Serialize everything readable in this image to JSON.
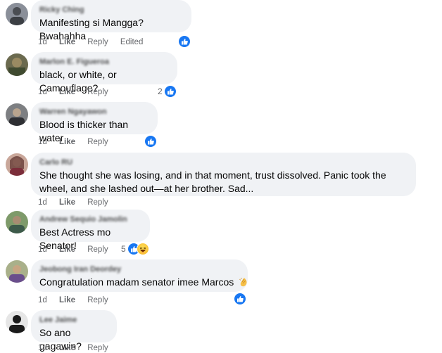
{
  "comments": [
    {
      "author": "Ricky Ching",
      "text": "Manifesting si Mangga? Bwahahha",
      "time": "1d",
      "like": "Like",
      "reply": "Reply",
      "edited": "Edited",
      "reaction_count": "",
      "reactions": [
        "like"
      ]
    },
    {
      "author": "Marlon E. Figueroa",
      "text": "black, or white, or Camouflage?",
      "time": "1d",
      "like": "Like",
      "reply": "Reply",
      "reaction_count": "2",
      "reactions": [
        "like"
      ]
    },
    {
      "author": "Warren Ngayawon",
      "text": "Blood is thicker than water",
      "time": "1d",
      "like": "Like",
      "reply": "Reply",
      "reaction_count": "",
      "reactions": [
        "like"
      ]
    },
    {
      "author": "Carlo RU",
      "text": "She thought she was losing, and in that moment, trust dissolved. Panic took the wheel, and she lashed out—at her brother. Sad...",
      "time": "1d",
      "like": "Like",
      "reply": "Reply",
      "reaction_count": "",
      "reactions": []
    },
    {
      "author": "Andrew Sequio Jamolin",
      "text": "Best Actress mo Senator!",
      "time": "1d",
      "like": "Like",
      "reply": "Reply",
      "reaction_count": "5",
      "reactions": [
        "like",
        "haha"
      ]
    },
    {
      "author": "Jeobong Iran Deordey",
      "text": "Congratulation madam senator imee Marcos",
      "emoji": "clapping-hands-icon",
      "time": "1d",
      "like": "Like",
      "reply": "Reply",
      "reaction_count": "",
      "reactions": [
        "like"
      ]
    },
    {
      "author": "Lee Jaime",
      "text": "So ano gagawin?",
      "time": "1d",
      "like": "Like",
      "reply": "Reply",
      "reaction_count": "",
      "reactions": []
    }
  ],
  "colors": {
    "bubble": "#f0f2f5",
    "like_blue": "#1877f2",
    "meta_gray": "#65676b"
  }
}
